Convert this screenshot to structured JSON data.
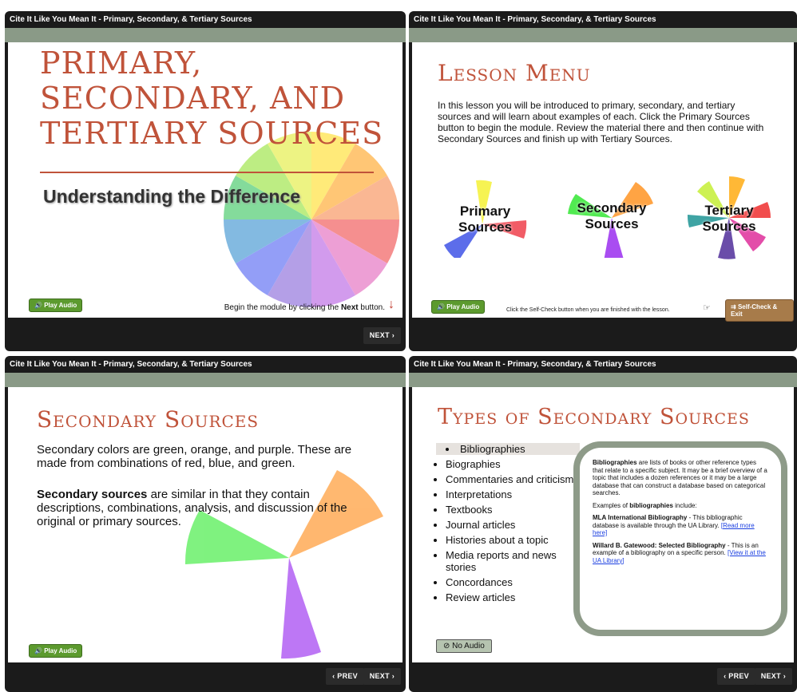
{
  "colors": {
    "accent_bar": "#8a9a87",
    "title_red": "#c0533a",
    "play_green": "#5c9a2e",
    "frame": "#1b1b1b"
  },
  "panel1": {
    "window_title": "Cite It Like You Mean It - Primary, Secondary, & Tertiary Sources",
    "title_line1": "PRIMARY,",
    "title_line2": "SECONDARY, AND",
    "title_line3": "TERTIARY SOURCES",
    "subtitle": "Understanding the Difference",
    "play_audio": "Play Audio",
    "instruction_prefix": "Begin the module by clicking the ",
    "instruction_bold": "Next",
    "instruction_suffix": " button.",
    "next": "NEXT"
  },
  "panel2": {
    "window_title": "Cite It Like You Mean It - Primary, Secondary, & Tertiary Sources",
    "title": "Lesson Menu",
    "paragraph": "In this lesson you will be introduced to primary, secondary, and tertiary sources and will learn about examples of each. Click the Primary Sources button to begin the module. Review the material there and then continue with Secondary Sources and finish up with Tertiary Sources.",
    "primary_line1": "Primary",
    "primary_line2": "Sources",
    "secondary_line1": "Secondary",
    "secondary_line2": "Sources",
    "tertiary_line1": "Tertiary",
    "tertiary_line2": "Sources",
    "play_audio": "Play Audio",
    "selfcheck_text": "Click the Self-Check  button when you are finished with the lesson.",
    "selfcheck_button": "Self-Check & Exit"
  },
  "panel3": {
    "window_title": "Cite It Like You Mean It - Primary, Secondary, & Tertiary Sources",
    "title": "Secondary Sources",
    "para1": "Secondary colors are green, orange, and purple. These are made from combinations of red, blue, and green.",
    "para2_bold": "Secondary sources",
    "para2_rest": " are similar in that they contain descriptions, combinations, analysis, and discussion of the original or primary sources.",
    "play_audio": "Play Audio",
    "prev": "PREV",
    "next": "NEXT"
  },
  "panel4": {
    "window_title": "Cite It Like You Mean It - Primary, Secondary, & Tertiary Sources",
    "title": "Types of Secondary Sources",
    "items": [
      "Bibliographies",
      "Biographies",
      "Commentaries and criticism",
      "Interpretations",
      "Textbooks",
      "Journal articles",
      "Histories about a topic",
      "Media reports and news stories",
      "Concordances",
      "Review articles"
    ],
    "no_audio": "No Audio",
    "box_p1_bold": "Bibliographies",
    "box_p1_rest": " are lists of books or other reference types that relate to a specific subject. It may be a brief overview of a topic that includes a dozen references or it may be a large database that can construct a database based on categorical searches.",
    "box_p2_prefix": "Examples of ",
    "box_p2_bold": "bibliographies",
    "box_p2_suffix": " include:",
    "box_p3_bold": "MLA International Bibliography",
    "box_p3_rest": " - This bibliographic database is available through the UA Library. ",
    "box_p3_link": "[Read more here]",
    "box_p4_bold": "Willard B. Gatewood: Selected Bibliography",
    "box_p4_rest": " - This is an example of a bibliography on a specific person. ",
    "box_p4_link": "[View it at the UA Library]",
    "prev": "PREV",
    "next": "NEXT"
  }
}
